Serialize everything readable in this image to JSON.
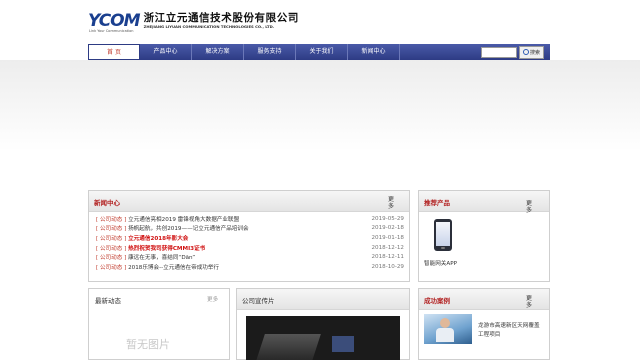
{
  "brand": {
    "logo_text": "YCOM",
    "logo_tagline": "Link Your Communication",
    "company_cn": "浙江立元通信技术股份有限公司",
    "company_en": "ZHEJIANG LIYUAN COMMUNICATION TECHNOLOGIES CO., LTD."
  },
  "nav": {
    "items": [
      "首  页",
      "产品中心",
      "解决方案",
      "服务支持",
      "关于我们",
      "新闻中心"
    ],
    "active_index": 0,
    "search_placeholder": "",
    "search_button": "搜索"
  },
  "news": {
    "title": "新闻中心",
    "more": "更多",
    "items": [
      {
        "category": "[ 公司动态 ]",
        "title": "立元通信亮相2019 雷锋视角大数据产业联盟",
        "date": "2019-05-29",
        "highlight": false
      },
      {
        "category": "[ 公司动态 ]",
        "title": "扬帆起航，共创2019——记立元通信产品培训会",
        "date": "2019-02-18",
        "highlight": false
      },
      {
        "category": "[ 公司动态 ]",
        "title": "立元通信2018年影大会",
        "date": "2019-01-18",
        "highlight": true
      },
      {
        "category": "[ 公司动态 ]",
        "title": "热烈祝贺我司获得CMMI3证书",
        "date": "2018-12-12",
        "highlight": true
      },
      {
        "category": "[ 公司动态 ]",
        "title": "康远在无事，喜结同“Dān”",
        "date": "2018-12-11",
        "highlight": false
      },
      {
        "category": "[ 公司动态 ]",
        "title": "2018乐博会--立元通信在帝成功举行",
        "date": "2018-10-29",
        "highlight": false
      }
    ]
  },
  "recommended": {
    "title": "推荐产品",
    "more": "更多",
    "caption": "智能网关APP"
  },
  "latest": {
    "title": "最新动态",
    "more": "更多",
    "placeholder": "暂无图片"
  },
  "promo": {
    "title": "公司宣传片"
  },
  "cases": {
    "title": "成功案例",
    "more": "更多",
    "caption": "龙游市高速新区天网覆盖工程项目"
  },
  "colors": {
    "nav": "#2d3b84",
    "accent": "#b22222",
    "panel_header": "#e8e8e8"
  }
}
